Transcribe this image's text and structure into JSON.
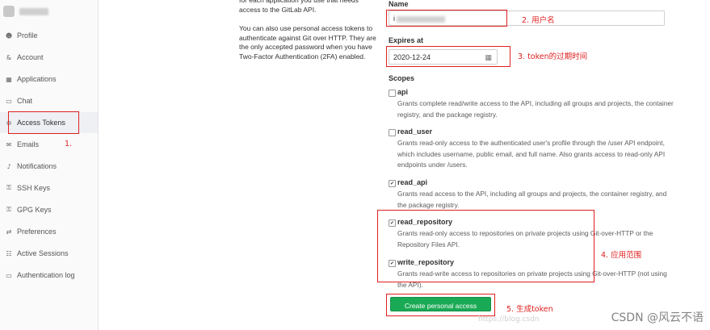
{
  "sidebar": {
    "items": [
      {
        "label": "Profile",
        "icon": "user-icon",
        "glyph": "☻",
        "active": false
      },
      {
        "label": "Account",
        "icon": "account-icon",
        "glyph": "&",
        "active": false
      },
      {
        "label": "Applications",
        "icon": "applications-icon",
        "glyph": "▦",
        "active": false
      },
      {
        "label": "Chat",
        "icon": "chat-icon",
        "glyph": "▭",
        "active": false
      },
      {
        "label": "Access Tokens",
        "icon": "access-tokens-icon",
        "glyph": "⊖",
        "active": true
      },
      {
        "label": "Emails",
        "icon": "email-icon",
        "glyph": "✉",
        "active": false
      },
      {
        "label": "Notifications",
        "icon": "bell-icon",
        "glyph": "♪",
        "active": false
      },
      {
        "label": "SSH Keys",
        "icon": "key-icon",
        "glyph": "⚿",
        "active": false
      },
      {
        "label": "GPG Keys",
        "icon": "gpg-key-icon",
        "glyph": "⚿",
        "active": false
      },
      {
        "label": "Preferences",
        "icon": "preferences-icon",
        "glyph": "⇄",
        "active": false
      },
      {
        "label": "Active Sessions",
        "icon": "sessions-icon",
        "glyph": "☷",
        "active": false
      },
      {
        "label": "Authentication log",
        "icon": "log-icon",
        "glyph": "▭",
        "active": false
      }
    ]
  },
  "info": {
    "p1": "for each application you use that needs access to the GitLab API.",
    "p2": "You can also use personal access tokens to authenticate against Git over HTTP. They are the only accepted password when you have Two-Factor Authentication (2FA) enabled."
  },
  "form": {
    "name_label": "Name",
    "name_value": "i",
    "expires_label": "Expires at",
    "expires_value": "2020-12-24",
    "scopes_label": "Scopes",
    "scopes": [
      {
        "name": "api",
        "checked": false,
        "description": "Grants complete read/write access to the API, including all groups and projects, the container registry, and the package registry."
      },
      {
        "name": "read_user",
        "checked": false,
        "description": "Grants read-only access to the authenticated user's profile through the /user API endpoint, which includes username, public email, and full name. Also grants access to read-only API endpoints under /users."
      },
      {
        "name": "read_api",
        "checked": true,
        "description": "Grants read access to the API, including all groups and projects, the container registry, and the package registry."
      },
      {
        "name": "read_repository",
        "checked": true,
        "description": "Grants read-only access to repositories on private projects using Git-over-HTTP or the Repository Files API."
      },
      {
        "name": "write_repository",
        "checked": true,
        "description": "Grants read-write access to repositories on private projects using Git-over-HTTP (not using the API)."
      }
    ],
    "submit_label": "Create personal access token"
  },
  "annotations": {
    "n1": "1.",
    "n2": "2. 用户名",
    "n3": "3. token的过期时间",
    "n4": "4. 应用范围",
    "n5": "5. 生成token"
  },
  "watermark": "CSDN @风云不语",
  "faint_url": "https://blog.csdn",
  "colors": {
    "accent_green": "#1aaa55",
    "annotation_red": "#e02020"
  }
}
